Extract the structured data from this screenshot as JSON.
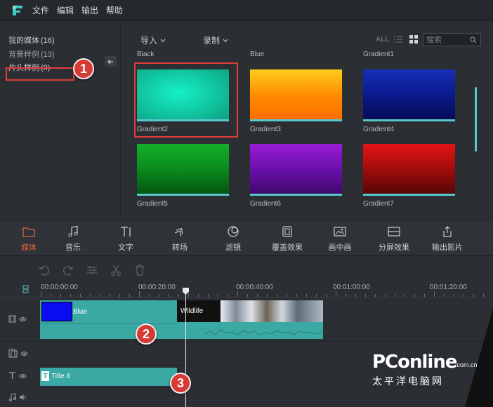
{
  "menu": {
    "items": [
      "文件",
      "编辑",
      "输出",
      "帮助"
    ]
  },
  "sidebar": {
    "categories": [
      {
        "label": "我的媒体",
        "count": "(16)"
      },
      {
        "label": "背景样例",
        "count": "(13)"
      },
      {
        "label": "片头样例",
        "count": "(9)"
      }
    ]
  },
  "media_toolbar": {
    "import_label": "导入",
    "record_label": "录制",
    "all_label": "ALL",
    "search_placeholder": "搜索"
  },
  "media_items": {
    "top_row_partial": [
      "Black",
      "Blue",
      "Gradient1"
    ],
    "items": [
      {
        "name": "Gradient2",
        "gradient": [
          "#18f0c8",
          "#10c49e",
          "#0e9c80"
        ]
      },
      {
        "name": "Gradient3",
        "gradient": [
          "#ffcc1a",
          "#ff8c00",
          "#ff6a00"
        ]
      },
      {
        "name": "Gradient4",
        "gradient": [
          "#1530b8",
          "#0a1a8c",
          "#070a50"
        ]
      },
      {
        "name": "Gradient5",
        "gradient": [
          "#12b02a",
          "#0a8a1e",
          "#04500e"
        ]
      },
      {
        "name": "Gradient6",
        "gradient": [
          "#9a1cd8",
          "#6a10a8",
          "#3a0866"
        ]
      },
      {
        "name": "Gradient7",
        "gradient": [
          "#e41414",
          "#a00c0c",
          "#500404"
        ]
      }
    ]
  },
  "callouts": [
    "1",
    "2",
    "3"
  ],
  "tools": [
    {
      "label": "媒体",
      "icon": "folder-icon",
      "active": true
    },
    {
      "label": "音乐",
      "icon": "music-note-icon",
      "active": false
    },
    {
      "label": "文字",
      "icon": "text-icon",
      "active": false
    },
    {
      "label": "转场",
      "icon": "transition-icon",
      "active": false
    },
    {
      "label": "滤镜",
      "icon": "filter-icon",
      "active": false
    },
    {
      "label": "覆盖效果",
      "icon": "overlay-icon",
      "active": false
    },
    {
      "label": "画中画",
      "icon": "picture-in-picture-icon",
      "active": false
    },
    {
      "label": "分屏效果",
      "icon": "split-screen-icon",
      "active": false
    },
    {
      "label": "输出影片",
      "icon": "export-icon",
      "active": false
    }
  ],
  "timeline": {
    "ruler": [
      "00:00:00:00",
      "00:00:20:00",
      "00:00:40:00",
      "00:01:00:00",
      "00:01:20:00"
    ],
    "clips": {
      "blue": "Blue",
      "wildlife": "Wildlife",
      "title": "Title 4"
    }
  },
  "watermark": {
    "brand": "PConline",
    "suffix": ".com.cn",
    "chinese": "太平洋电脑网"
  },
  "colors": {
    "accent": "#e0643f",
    "teal": "#3aa9a4",
    "highlight": "#e23b3b"
  }
}
